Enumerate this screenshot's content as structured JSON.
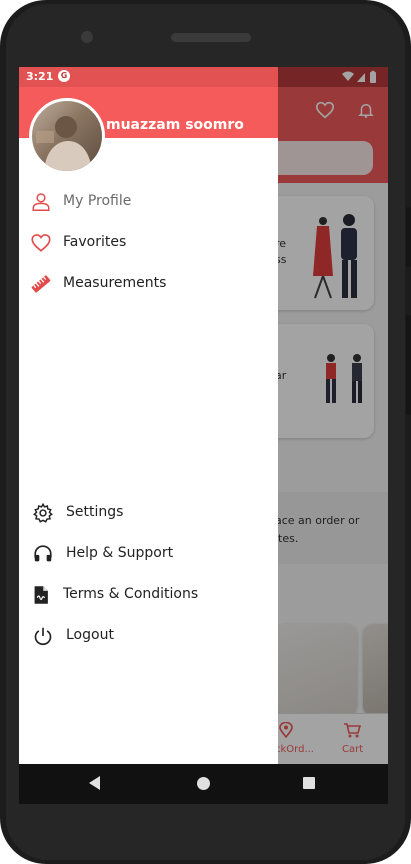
{
  "status_bar": {
    "time": "3:21",
    "g_badge": "G"
  },
  "drawer": {
    "username": "muazzam soomro",
    "top_items": [
      {
        "label": "My Profile",
        "icon": "person-icon"
      },
      {
        "label": "Favorites",
        "icon": "heart-icon"
      },
      {
        "label": "Measurements",
        "icon": "ruler-icon"
      }
    ],
    "bottom_items": [
      {
        "label": "Settings",
        "icon": "gear-icon"
      },
      {
        "label": "Help & Support",
        "icon": "headphones-icon"
      },
      {
        "label": "Terms & Conditions",
        "icon": "document-icon"
      },
      {
        "label": "Logout",
        "icon": "power-icon"
      }
    ]
  },
  "background_app": {
    "card1_text": [
      "re",
      "ss"
    ],
    "card2_text": [
      "ar"
    ],
    "banner_text": [
      "ace an order or",
      "ites."
    ],
    "nav_labels": [
      "ckOrd...",
      "Cart"
    ]
  },
  "colors": {
    "accent": "#f65b5b",
    "icon_red": "#e24b4b",
    "scrim": "rgba(0,0,0,0.36)"
  }
}
